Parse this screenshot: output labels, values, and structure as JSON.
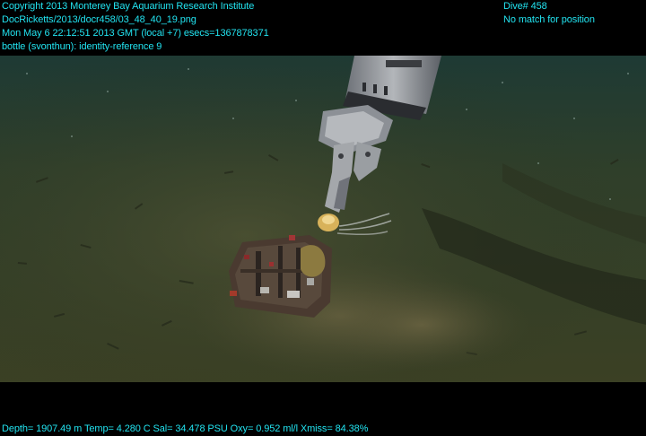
{
  "overlay": {
    "top_left": [
      "Copyright 2013 Monterey Bay Aquarium Research Institute",
      "DocRicketts/2013/docr458/03_48_40_19.png",
      "Mon May  6 22:12:51 2013 GMT (local +7)  esecs=1367878371",
      "bottle (svonthun): identity-reference 9"
    ],
    "top_right": [
      "Dive# 458",
      "No match for position"
    ],
    "bottom": "Depth= 1907.49 m  Temp= 4.280 C  Sal= 34.478 PSU  Oxy= 0.952 ml/l  Xmiss= 84.38%"
  },
  "colors": {
    "overlay_text": "#22e3f0",
    "seafloor": "#3d4226",
    "water": "#1f3328",
    "letterbox": "#000000"
  }
}
